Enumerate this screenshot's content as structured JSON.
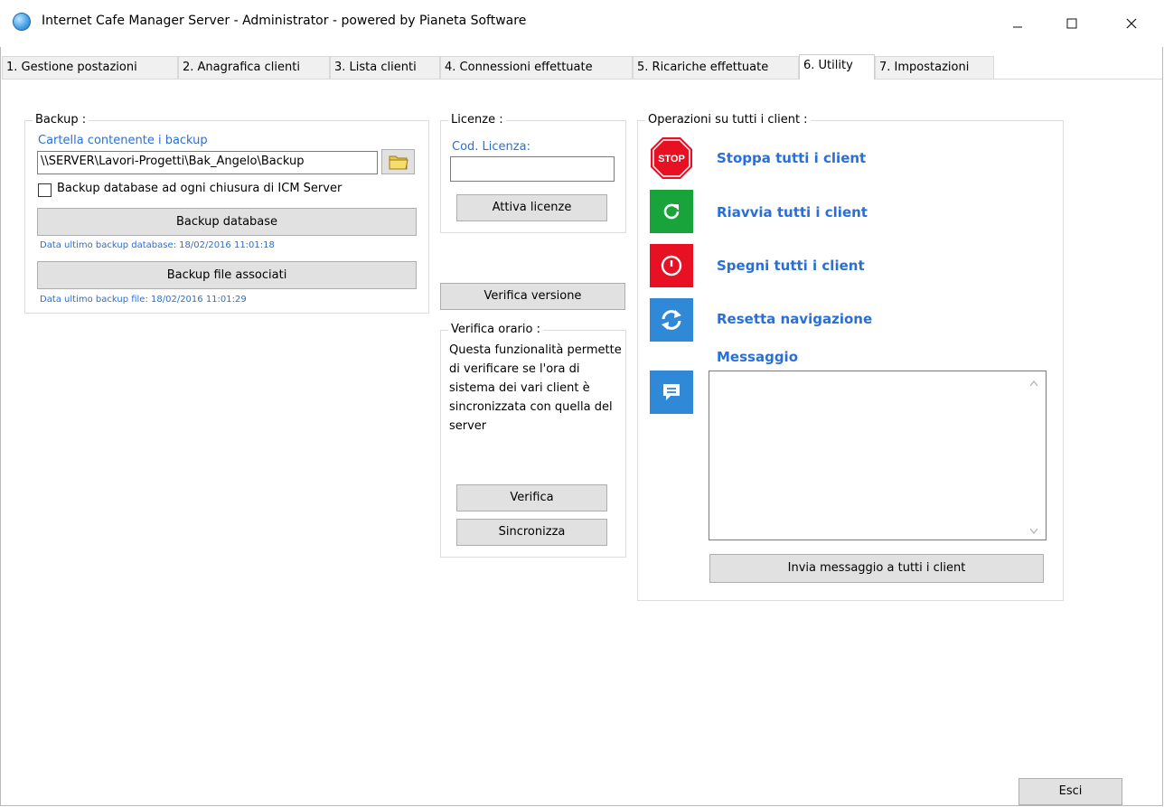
{
  "window": {
    "title": "Internet Cafe Manager Server - Administrator - powered by Pianeta Software"
  },
  "tabs": [
    {
      "label": "1. Gestione postazioni"
    },
    {
      "label": "2. Anagrafica clienti"
    },
    {
      "label": "3. Lista clienti"
    },
    {
      "label": "4. Connessioni effettuate"
    },
    {
      "label": "5. Ricariche effettuate"
    },
    {
      "label": "6. Utility",
      "active": true
    },
    {
      "label": "7. Impostazioni"
    }
  ],
  "backup": {
    "title": "Backup :",
    "folder_label": "Cartella contenente i backup",
    "folder_value": "\\\\SERVER\\Lavori-Progetti\\Bak_Angelo\\Backup",
    "checkbox_label": "Backup database ad ogni chiusura di ICM Server",
    "checkbox_checked": false,
    "db_button": "Backup database",
    "db_info": "Data ultimo backup database: 18/02/2016 11:01:18",
    "files_button": "Backup file associati",
    "files_info": "Data ultimo backup file: 18/02/2016 11:01:29"
  },
  "licenze": {
    "title": "Licenze :",
    "cod_label": "Cod. Licenza:",
    "cod_value": "",
    "activate_button": "Attiva licenze"
  },
  "verifica_versione_button": "Verifica versione",
  "verifica_orario": {
    "title": "Verifica orario :",
    "description": "Questa funzionalità permette di verificare se l'ora di sistema dei vari client è sincronizzata con quella del server",
    "verify_button": "Verifica",
    "sync_button": "Sincronizza"
  },
  "operazioni": {
    "title": "Operazioni su tutti i client :",
    "items": [
      {
        "icon": "stop-icon",
        "icon_text": "STOP",
        "label": "Stoppa tutti i client",
        "color": "#e81123"
      },
      {
        "icon": "restart-icon",
        "label": "Riavvia tutti i client",
        "color": "#19a33b"
      },
      {
        "icon": "power-icon",
        "label": "Spegni tutti i client",
        "color": "#e81123"
      },
      {
        "icon": "reset-navigation-icon",
        "label": "Resetta navigazione",
        "color": "#2f89d6"
      }
    ],
    "message_label": "Messaggio",
    "message_icon": "chat-icon",
    "message_icon_color": "#2f89d6",
    "message_value": "",
    "send_button": "Invia messaggio a tutti i client"
  },
  "exit_button": "Esci",
  "colors": {
    "link": "#2a6fd6",
    "button_bg": "#e1e1e1",
    "button_border": "#adadad"
  }
}
